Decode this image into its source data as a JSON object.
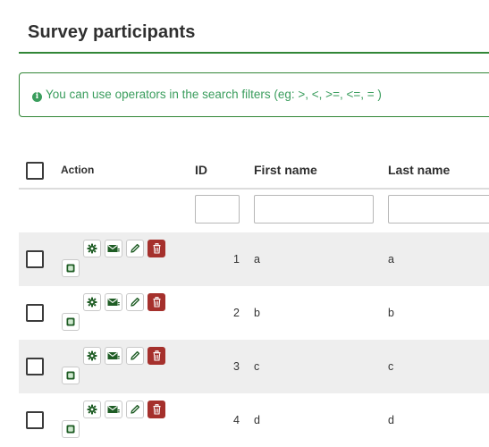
{
  "page": {
    "title": "Survey participants"
  },
  "alert": {
    "icon": "info-circle-icon",
    "text": "You can use operators in the search filters (eg: >, <, >=, <=, = )"
  },
  "table": {
    "columns": {
      "action": "Action",
      "id": "ID",
      "first_name": "First name",
      "last_name": "Last name"
    },
    "rows": [
      {
        "id": "1",
        "first_name": "a",
        "last_name": "a"
      },
      {
        "id": "2",
        "first_name": "b",
        "last_name": "b"
      },
      {
        "id": "3",
        "first_name": "c",
        "last_name": "c"
      },
      {
        "id": "4",
        "first_name": "d",
        "last_name": "d"
      }
    ],
    "row_actions": [
      "gear-icon",
      "envelope-icon",
      "pencil-icon",
      "trash-icon",
      "survey-icon"
    ]
  },
  "colors": {
    "accent_green": "#328637",
    "info_text": "#3a9d5d",
    "delete_red": "#a5302c",
    "row_stripe": "#eeeeee"
  }
}
